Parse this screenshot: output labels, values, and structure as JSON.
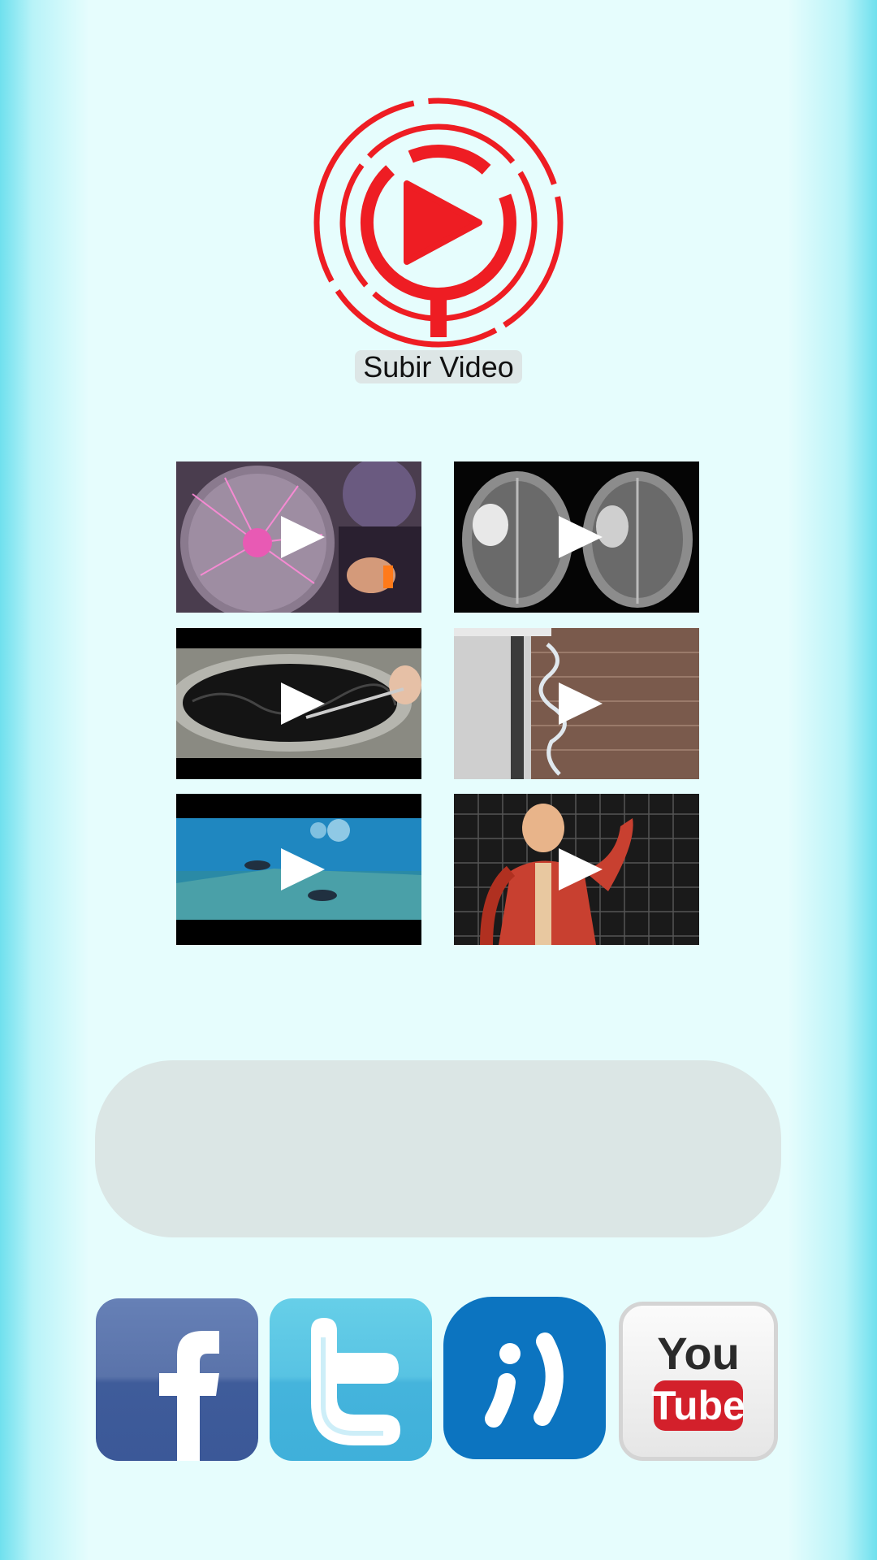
{
  "upload": {
    "label": "Subir Video",
    "logo_icon": "circular-play-logo-icon",
    "logo_color": "#ee1d23"
  },
  "videos": [
    {
      "subject": "plasma-ball"
    },
    {
      "subject": "brain-mri"
    },
    {
      "subject": "black-liquid-pot"
    },
    {
      "subject": "water-spiral"
    },
    {
      "subject": "underwater-divers"
    },
    {
      "subject": "human-anatomy"
    }
  ],
  "social": [
    {
      "name": "facebook",
      "icon": "facebook-icon"
    },
    {
      "name": "twitter",
      "icon": "twitter-icon"
    },
    {
      "name": "tuenti",
      "icon": "tuenti-icon"
    },
    {
      "name": "youtube",
      "icon": "youtube-icon",
      "text_top": "You",
      "text_bottom": "Tube"
    }
  ]
}
